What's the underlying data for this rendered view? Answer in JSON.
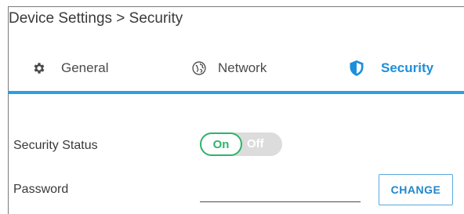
{
  "header": {
    "breadcrumb": "Device Settings > Security"
  },
  "tabs": [
    {
      "label": "General",
      "icon": "gear-icon",
      "active": false
    },
    {
      "label": "Network",
      "icon": "globe-icon",
      "active": false
    },
    {
      "label": "Security",
      "icon": "shield-icon",
      "active": true
    }
  ],
  "security_status": {
    "label": "Security Status",
    "on_text": "On",
    "off_text": "Off",
    "state": "On"
  },
  "password": {
    "label": "Password",
    "value": "",
    "button_label": "CHANGE"
  },
  "colors": {
    "accent": "#2a9fe4",
    "toggle_on": "#2fb36b",
    "toggle_track": "#dcdcdc",
    "button_text": "#1f86cc"
  }
}
